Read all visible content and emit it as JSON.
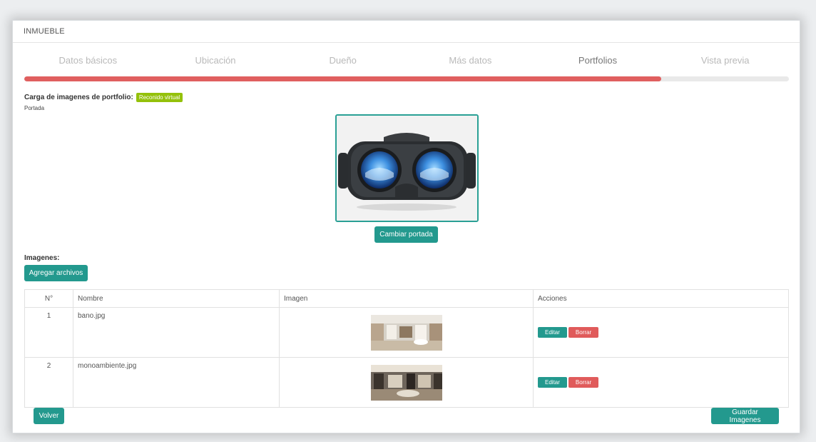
{
  "header": {
    "title": "INMUEBLE"
  },
  "tabs": [
    {
      "label": "Datos básicos"
    },
    {
      "label": "Ubicación"
    },
    {
      "label": "Dueño"
    },
    {
      "label": "Más datos"
    },
    {
      "label": "Portfolios"
    },
    {
      "label": "Vista previa"
    }
  ],
  "active_tab": "Portfolios",
  "progress": {
    "percent": 83.3
  },
  "upload": {
    "title": "Carga de imagenes de portfolio:",
    "badge": "Reconido virtual",
    "cover_label": "Portada",
    "change_cover_label": "Cambiar portada",
    "cover_image": "vr-headset-icon"
  },
  "images": {
    "title": "Imagenes:",
    "add_files_label": "Agregar archivos",
    "columns": [
      "N°",
      "Nombre",
      "Imagen",
      "Acciones"
    ],
    "rows": [
      {
        "num": "1",
        "name": "bano.jpg",
        "thumb": "panorama-bathroom",
        "edit": "Editar",
        "delete": "Borrar"
      },
      {
        "num": "2",
        "name": "monoambiente.jpg",
        "thumb": "panorama-room",
        "edit": "Editar",
        "delete": "Borrar"
      }
    ]
  },
  "footer": {
    "back_label": "Volver",
    "save_label": "Guardar Imagenes"
  },
  "colors": {
    "teal": "#23998e",
    "red": "#e05f5f",
    "green_badge": "#94c10b"
  }
}
